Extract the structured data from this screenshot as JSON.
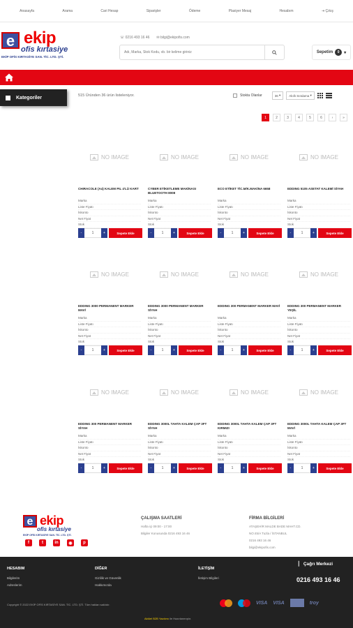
{
  "topnav": [
    "Anasayfa",
    "Arama",
    "Cari Hesap",
    "Siparişler",
    "Ödeme",
    "Plasiyer Mesaj",
    "Hesabım",
    "Çıkış"
  ],
  "brand": {
    "initial": "e",
    "name": "ekip",
    "subtitle": "ofis kırtasiye",
    "company": "EKİP OFİS KIRTASİYE SAN. TİC. LTD. ŞTİ."
  },
  "contact": {
    "phone": "0216 493 16 46",
    "email": "bilgi@ekipofis.com"
  },
  "search": {
    "placeholder": "Adı, Marka, Stok Kodu, vb. bir kelime giriniz"
  },
  "cart": {
    "label": "Sepetim",
    "count": "0"
  },
  "categories_label": "Kategoriler",
  "result_text": "515 Üründen 36 ürün listeleniyor.",
  "options": {
    "stock_label": "Stokta Olanlar",
    "per_page": "36",
    "sort": "Akıllı Sıralama"
  },
  "pagination": [
    "1",
    "2",
    "3",
    "4",
    "5",
    "6",
    "›",
    "»"
  ],
  "no_image_text": "NO IMAGE",
  "product_field_labels": [
    "Marka",
    "Liste Fiyatı",
    "İskonto",
    "Net Fiyat",
    "Stok"
  ],
  "add_to_cart_label": "Sepete Ekle",
  "quantity_default": "1",
  "products": [
    {
      "name": "CHIRACOLE (A4) KALEM PIL 4'LÜ KART"
    },
    {
      "name": "CYBER ETİKETLEME MAKİNASI BLUETOOTH 8008"
    },
    {
      "name": "ECO ETİKET TİC.M/K.MAKİNA 6658"
    },
    {
      "name": "EDDING 5105 ASETAT KALEMİ SİYAH"
    },
    {
      "name": "EDDING 3000 PERMANENT MARKER MAVİ"
    },
    {
      "name": "EDDING 3000 PERMANENT MARKER SİYAH"
    },
    {
      "name": "EDDING 300 PERMANENT MARKER MAVİ"
    },
    {
      "name": "EDDING 300 PERMANENT MARKER YEŞİL"
    },
    {
      "name": "EDDING 300 PERMANENT MARKER SİYAH"
    },
    {
      "name": "EDDING 3000L TAHTA KALEM ÇAP 3FT SİYAH"
    },
    {
      "name": "EDDING 3000L TAHTA KALEM ÇAP 3FT KIRMIZI"
    },
    {
      "name": "EDDING 3000L TAHTA KALEM ÇAP 3FT MAVİ"
    }
  ],
  "footer": {
    "hours_title": "ÇALIŞMA SAATLERİ",
    "hours_lines": [
      "Hafta içi 09:00 - 17:00",
      "Bilgiler Konusunda 0216 493 16 46"
    ],
    "company_title": "FİRMA BİLGİLERİ",
    "company_lines": [
      "ATAŞEHİR MALDE BADE MAHT.CD.",
      "NO:45/A Tuzla / İSTANBUL",
      "0216 493 16 46",
      "bilgi@ekipofis.com"
    ],
    "account_title": "HESABIM",
    "account_items": [
      "Bilgilerim",
      "Adreslerim"
    ],
    "other_title": "DİĞER",
    "other_items": [
      "Gizlilik ve Güvenlik",
      "Hakkımızda"
    ],
    "contact_title": "İLETİŞİM",
    "contact_items": [
      "İletişim Bilgileri"
    ],
    "call_center_label": "Çağrı Merkezi",
    "call_center_phone": "0216 493 16 46",
    "copyright": "Copyright © 2022 EKİP OFİS KIRTASİYE SAN. TİC. LTD. ŞTİ. Tüm hakları saklıdır.",
    "powered_prefix": "Aktüel",
    "powered_brand": "B2B Yazılımı",
    "powered_suffix": "ile Hazırlanmıştır.",
    "card_brands": [
      "VISA",
      "VISA",
      "troy"
    ]
  },
  "colors": {
    "brand_red": "#e30613",
    "brand_blue": "#2b3f8f",
    "dark": "#222222"
  }
}
